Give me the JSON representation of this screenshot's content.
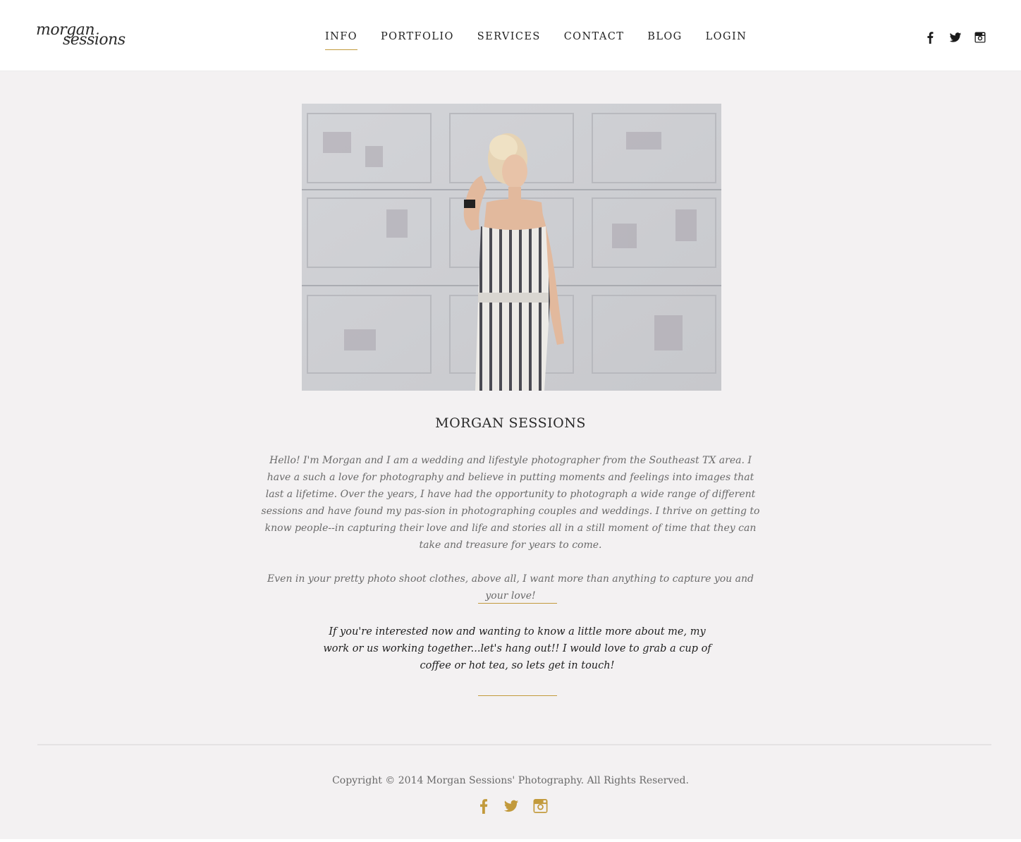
{
  "header": {
    "logo_line1": "morgan",
    "logo_line2": "sessions",
    "nav": [
      {
        "label": "INFO",
        "active": true
      },
      {
        "label": "PORTFOLIO",
        "active": false
      },
      {
        "label": "SERVICES",
        "active": false
      },
      {
        "label": "CONTACT",
        "active": false
      },
      {
        "label": "BLOG",
        "active": false
      },
      {
        "label": "LOGIN",
        "active": false
      }
    ],
    "social_icons": [
      "facebook-icon",
      "twitter-icon",
      "instagram-icon"
    ]
  },
  "main": {
    "title": "MORGAN SESSIONS",
    "bio_paragraph_1": "Hello! I'm Morgan and I am a wedding and lifestyle photographer from the Southeast TX area. I have a such a love for photography and believe in putting moments and feelings into images that last a lifetime. Over the years, I have had the opportunity to photograph a wide range of different sessions and have found my pas-sion in photographing couples and weddings. I thrive on getting to know people--in capturing their love and life and stories all in a still moment of time that they can take and treasure for years to come.",
    "bio_paragraph_2": "Even in your pretty photo shoot clothes, above all, I want more than anything to capture you and your love!",
    "cta": "If you're interested now and wanting to know a little more about me, my work or us working together...let's hang out!! I would love to grab a cup of coffee or hot tea, so lets get in touch!"
  },
  "footer": {
    "copyright": "Copyright © 2014 Morgan Sessions' Photography. All Rights Reserved.",
    "social_icons": [
      "facebook-icon",
      "twitter-icon",
      "instagram-icon"
    ]
  },
  "colors": {
    "accent_gold": "#c29a3c",
    "background": "#f3f1f2",
    "header_bg": "#ffffff"
  }
}
